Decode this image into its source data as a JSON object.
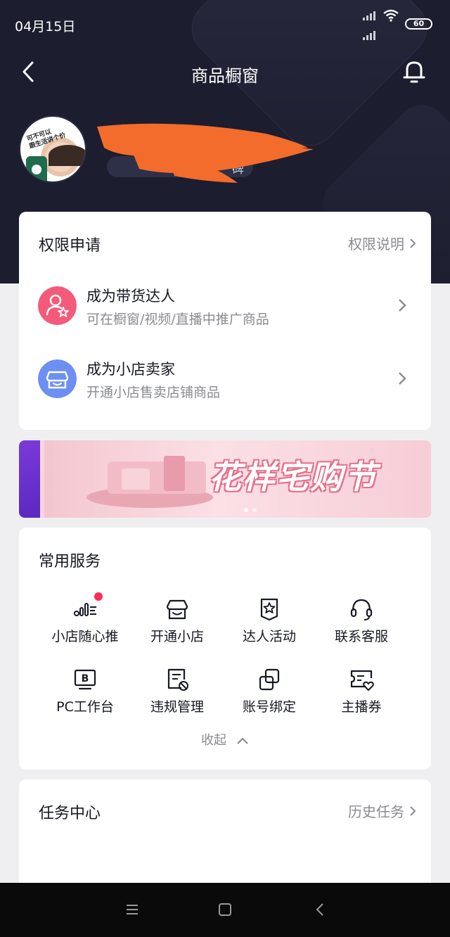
{
  "status_bar": {
    "time": "04月15日",
    "battery": "60"
  },
  "header": {
    "title": "商品橱窗"
  },
  "profile": {
    "avatar_caption": "可不可以\n跟生活讲个价",
    "tag_text_partial": "碑"
  },
  "permissions": {
    "title": "权限申请",
    "link": "权限说明",
    "items": [
      {
        "name": "成为带货达人",
        "desc": "可在橱窗/视频/直播中推广商品",
        "icon": "user-star-icon",
        "color": "#f45a7a"
      },
      {
        "name": "成为小店卖家",
        "desc": "开通小店售卖店铺商品",
        "icon": "store-icon",
        "color": "#6d8ff2"
      }
    ]
  },
  "banner": {
    "text": "花样宅购节"
  },
  "services": {
    "title": "常用服务",
    "items": [
      {
        "label": "小店随心推",
        "icon": "boost-icon",
        "badge": true
      },
      {
        "label": "开通小店",
        "icon": "store-icon"
      },
      {
        "label": "达人活动",
        "icon": "star-badge-icon"
      },
      {
        "label": "联系客服",
        "icon": "headset-icon"
      },
      {
        "label": "PC工作台",
        "icon": "pc-icon"
      },
      {
        "label": "违规管理",
        "icon": "violation-icon"
      },
      {
        "label": "账号绑定",
        "icon": "link-account-icon"
      },
      {
        "label": "主播券",
        "icon": "coupon-icon"
      }
    ],
    "collapse_label": "收起"
  },
  "tasks": {
    "title": "任务中心",
    "link": "历史任务"
  },
  "colors": {
    "accent_red": "#fe2c55",
    "header_bg": "#1c1d2e",
    "redact": "#f36c2c"
  }
}
